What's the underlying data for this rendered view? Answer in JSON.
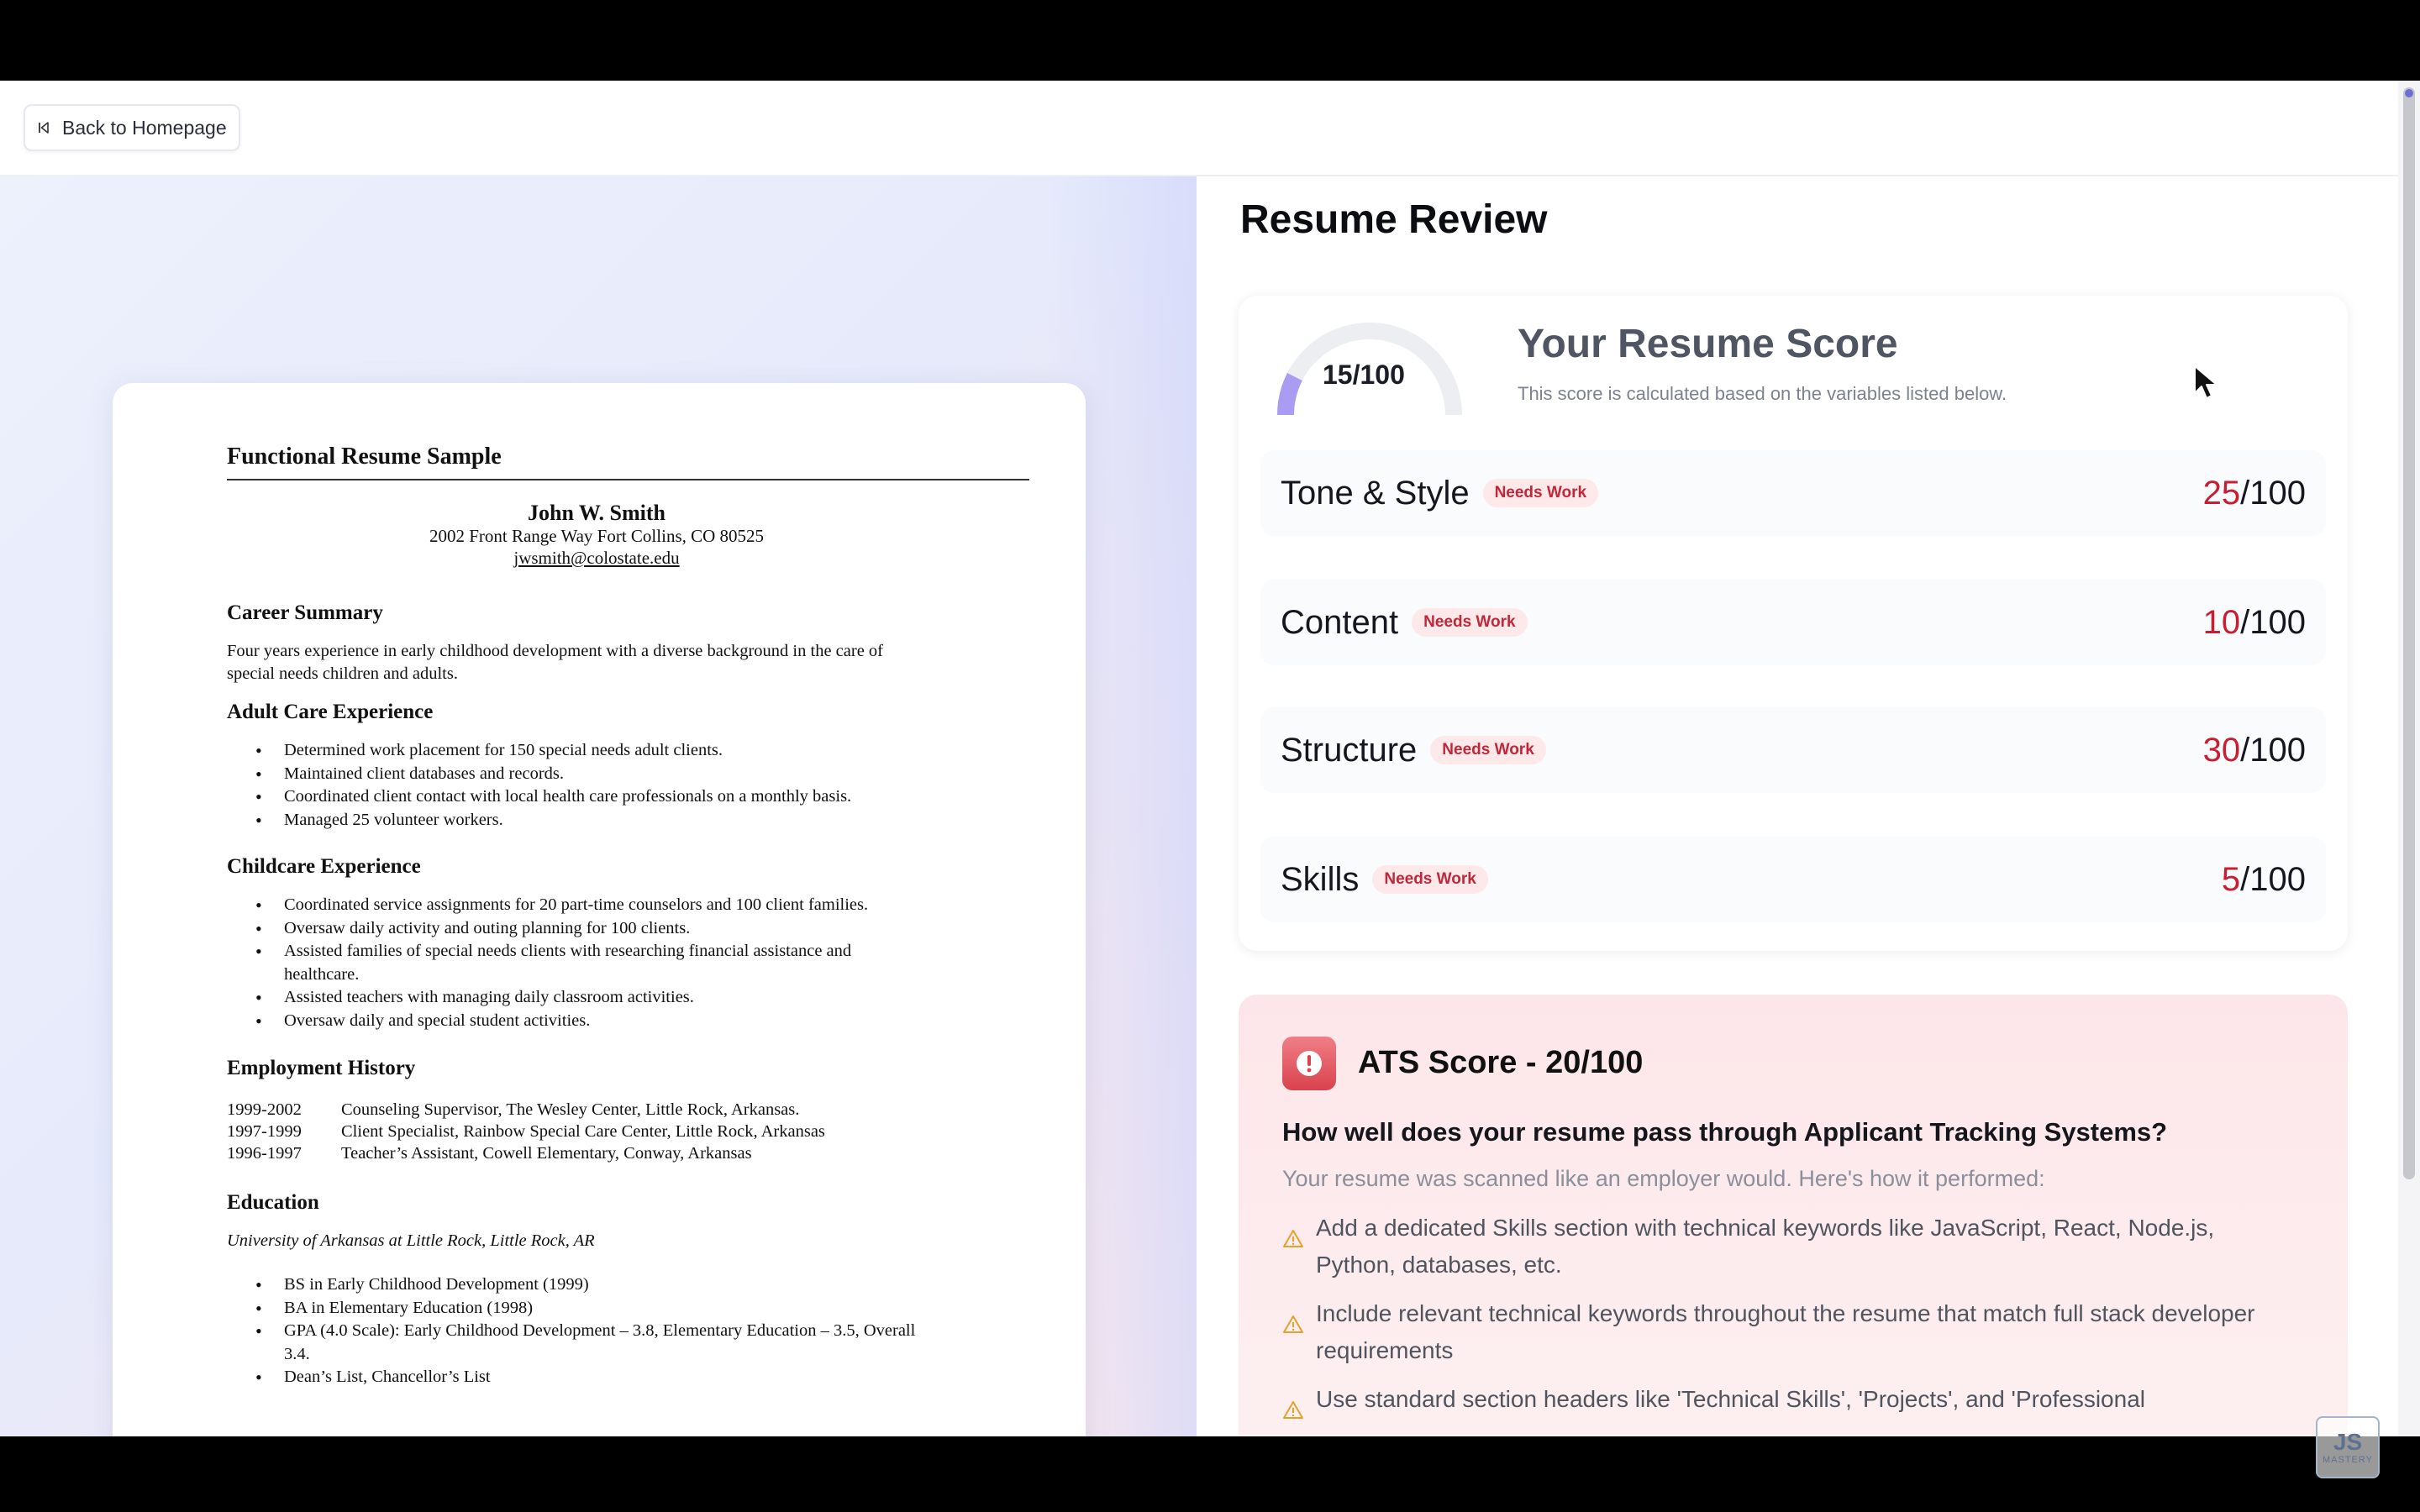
{
  "topbar": {
    "back_label": "Back to Homepage"
  },
  "resume": {
    "title": "Functional Resume Sample",
    "name": "John W. Smith",
    "address": "2002 Front Range Way Fort Collins, CO 80525",
    "email": "jwsmith@colostate.edu",
    "career_summary": {
      "heading": "Career Summary",
      "text_line1": "Four years experience in early childhood development with a diverse background in the care of",
      "text_line2": "special needs children and adults."
    },
    "adult_care": {
      "heading": "Adult Care Experience",
      "items": [
        "Determined work placement for 150 special needs adult clients.",
        "Maintained client databases and records.",
        "Coordinated client contact with local health care professionals on a monthly basis.",
        "Managed 25 volunteer workers."
      ]
    },
    "childcare": {
      "heading": "Childcare Experience",
      "items": [
        "Coordinated service assignments for 20 part-time counselors and 100 client families.",
        "Oversaw daily activity and outing planning for 100 clients.",
        "Assisted families of special needs clients with researching financial assistance and healthcare.",
        "Assisted teachers with managing daily classroom activities.",
        "Oversaw daily and special student activities."
      ]
    },
    "employment": {
      "heading": "Employment History",
      "rows": [
        {
          "years": "1999-2002",
          "role": "Counseling Supervisor, The Wesley Center, Little Rock, Arkansas."
        },
        {
          "years": "1997-1999",
          "role": "Client Specialist, Rainbow Special Care Center, Little Rock, Arkansas"
        },
        {
          "years": "1996-1997",
          "role": "Teacher’s Assistant, Cowell Elementary, Conway, Arkansas"
        }
      ]
    },
    "education": {
      "heading": "Education",
      "school": "University of Arkansas at Little Rock, Little Rock, AR",
      "items": [
        "BS in Early Childhood Development (1999)",
        "BA in Elementary Education (1998)",
        "GPA (4.0 Scale):  Early Childhood Development – 3.8, Elementary Education – 3.5, Overall 3.4.",
        "Dean’s List, Chancellor’s List"
      ]
    }
  },
  "review": {
    "title": "Resume Review",
    "overall": {
      "value_text": "15/100",
      "score": 15,
      "max": 100,
      "heading": "Your Resume Score",
      "subtitle": "This score is calculated based on the variables listed below."
    },
    "categories": [
      {
        "name": "Tone & Style",
        "badge": "Needs Work",
        "score": "25",
        "suffix": "/100"
      },
      {
        "name": "Content",
        "badge": "Needs Work",
        "score": "10",
        "suffix": "/100"
      },
      {
        "name": "Structure",
        "badge": "Needs Work",
        "score": "30",
        "suffix": "/100"
      },
      {
        "name": "Skills",
        "badge": "Needs Work",
        "score": "5",
        "suffix": "/100"
      }
    ],
    "ats": {
      "title": "ATS Score - 20/100",
      "question": "How well does your resume pass through Applicant Tracking Systems?",
      "description": "Your resume was scanned like an employer would. Here's how it performed:",
      "tips": [
        "Add a dedicated Skills section with technical keywords like JavaScript, React, Node.js, Python, databases, etc.",
        "Include relevant technical keywords throughout the resume that match full stack developer requirements",
        "Use standard section headers like 'Technical Skills', 'Projects', and 'Professional"
      ]
    }
  },
  "watermark": {
    "main": "JS",
    "sub": "MASTERY"
  },
  "colors": {
    "accent": "#8b83f0",
    "danger": "#c81e32",
    "badge_bg": "#fde8ea"
  }
}
